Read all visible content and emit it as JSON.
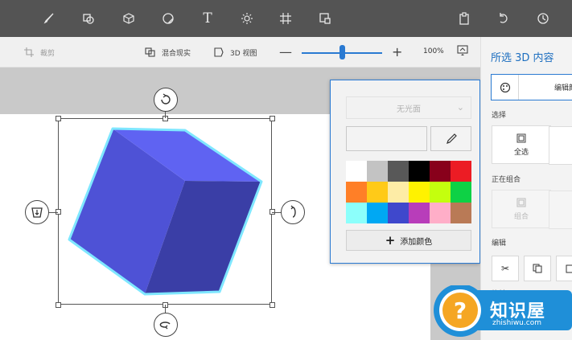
{
  "toolbar": {
    "icons": [
      "brush-icon",
      "2d-shapes-icon",
      "3d-objects-icon",
      "stickers-icon",
      "text-icon",
      "effects-icon",
      "canvas-icon",
      "remix3d-icon",
      "paste-icon",
      "undo-icon",
      "history-icon"
    ]
  },
  "subbar": {
    "crop_label": "裁剪",
    "mixed_reality_label": "混合现实",
    "view3d_label": "3D 视图",
    "zoom_label": "100%",
    "zoom_value": 100
  },
  "color_picker": {
    "finish_label": "无光面",
    "hex_value": "",
    "swatches": [
      "#ffffff",
      "#c3c3c3",
      "#585858",
      "#000000",
      "#88001b",
      "#ec1c24",
      "#ff7f27",
      "#ffca18",
      "#fdeca6",
      "#fff200",
      "#c4ff0e",
      "#0ed145",
      "#8cfffb",
      "#00a8f3",
      "#3f48cc",
      "#b83dba",
      "#ffaec8",
      "#b97a56"
    ],
    "add_color_label": "添加颜色"
  },
  "panel": {
    "title": "所选 3D 内容",
    "edit_tab_label": "编辑颜",
    "select_label": "选择",
    "select_all_label": "全选",
    "grouping_label": "正在组合",
    "group_label": "组合",
    "edit_label": "编辑",
    "rotate_label": "旋转"
  },
  "watermark": {
    "name": "知识屋",
    "url": "zhishiwu.com"
  },
  "colors": {
    "accent": "#2a7ad2",
    "cube_top": "#5f63f2",
    "cube_left": "#4e52d6",
    "cube_right": "#3a3ea6",
    "cube_outline": "#7fe7ff"
  }
}
